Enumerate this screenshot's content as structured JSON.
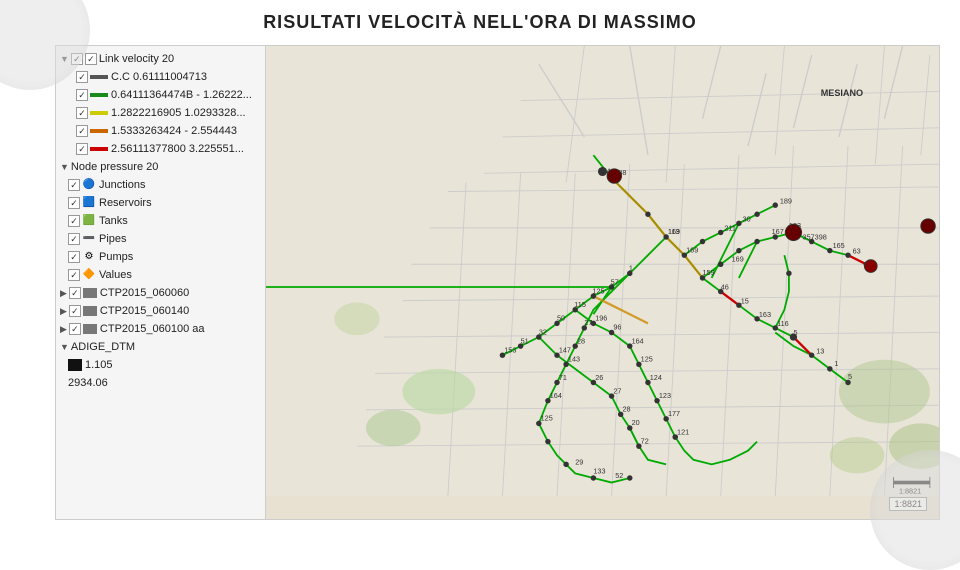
{
  "title": "RISULTATI VELOCITÀ NELL'ORA DI MASSIMO",
  "layer_panel": {
    "items": [
      {
        "id": "link-velocity",
        "level": 1,
        "expandable": true,
        "expanded": true,
        "checkbox": true,
        "label": "Link velocity 20",
        "icon": null,
        "swatch": null
      },
      {
        "id": "cc-range1",
        "level": 2,
        "expandable": false,
        "expanded": false,
        "checkbox": true,
        "label": "C.C  0.61111004713",
        "icon": null,
        "swatch": "#3a3a3a"
      },
      {
        "id": "cc-range2",
        "level": 2,
        "expandable": false,
        "expanded": false,
        "checkbox": true,
        "label": "0.64111364474B - 1.26222...",
        "icon": null,
        "swatch": "#1f7a1f"
      },
      {
        "id": "cc-range3",
        "level": 2,
        "expandable": false,
        "expanded": false,
        "checkbox": true,
        "label": "1.2822216905  1.0293328...",
        "icon": null,
        "swatch": "#cccc00"
      },
      {
        "id": "cc-range4",
        "level": 2,
        "expandable": false,
        "expanded": false,
        "checkbox": true,
        "label": "1.5333263424 - 2.554443",
        "icon": null,
        "swatch": "#cc6600"
      },
      {
        "id": "cc-range5",
        "level": 2,
        "expandable": false,
        "expanded": false,
        "checkbox": true,
        "label": "2.56111377800  3.225551...",
        "icon": null,
        "swatch": "#cc0000"
      },
      {
        "id": "node-pressure",
        "level": 1,
        "expandable": true,
        "expanded": true,
        "checkbox": false,
        "label": "Node pressure 20",
        "icon": null,
        "swatch": null
      },
      {
        "id": "junctions",
        "level": 2,
        "expandable": false,
        "expanded": false,
        "checkbox": true,
        "label": "Junctions",
        "icon": "junction",
        "swatch": null
      },
      {
        "id": "reservoirs",
        "level": 2,
        "expandable": false,
        "expanded": false,
        "checkbox": true,
        "label": "Reservoirs",
        "icon": "reservoir",
        "swatch": null
      },
      {
        "id": "tanks",
        "level": 2,
        "expandable": false,
        "expanded": false,
        "checkbox": true,
        "label": "Tanks",
        "icon": "tank",
        "swatch": null
      },
      {
        "id": "pipes",
        "level": 2,
        "expandable": false,
        "expanded": false,
        "checkbox": true,
        "label": "Pipes",
        "icon": "pipe",
        "swatch": null
      },
      {
        "id": "pumps",
        "level": 2,
        "expandable": false,
        "expanded": false,
        "checkbox": true,
        "label": "Pumps",
        "icon": "pump",
        "swatch": null
      },
      {
        "id": "values",
        "level": 2,
        "expandable": false,
        "expanded": false,
        "checkbox": true,
        "label": "Values",
        "icon": "valve",
        "swatch": null
      },
      {
        "id": "ctp2015-060060",
        "level": 1,
        "expandable": true,
        "expanded": false,
        "checkbox": true,
        "label": "CTP2015_060060",
        "icon": null,
        "swatch": null
      },
      {
        "id": "ctp2015-060140",
        "level": 1,
        "expandable": true,
        "expanded": false,
        "checkbox": true,
        "label": "CTP2015_060140",
        "icon": null,
        "swatch": null
      },
      {
        "id": "ctp2015-060100-aa",
        "level": 1,
        "expandable": true,
        "expanded": false,
        "checkbox": true,
        "label": "CTP2015_060100 aa",
        "icon": null,
        "swatch": null
      },
      {
        "id": "adige-dtm",
        "level": 1,
        "expandable": true,
        "expanded": true,
        "checkbox": false,
        "label": "ADIGE_DTM",
        "icon": null,
        "swatch": null
      },
      {
        "id": "dtm-val1",
        "level": 2,
        "expandable": false,
        "expanded": false,
        "checkbox": false,
        "label": "1.105",
        "icon": null,
        "swatch": "#1a1a1a"
      },
      {
        "id": "dtm-val2",
        "level": 2,
        "expandable": false,
        "expanded": false,
        "checkbox": false,
        "label": "2934.06",
        "icon": null,
        "swatch": null
      }
    ]
  },
  "map": {
    "scale_label": "1:8821",
    "location": "MESIANO"
  }
}
